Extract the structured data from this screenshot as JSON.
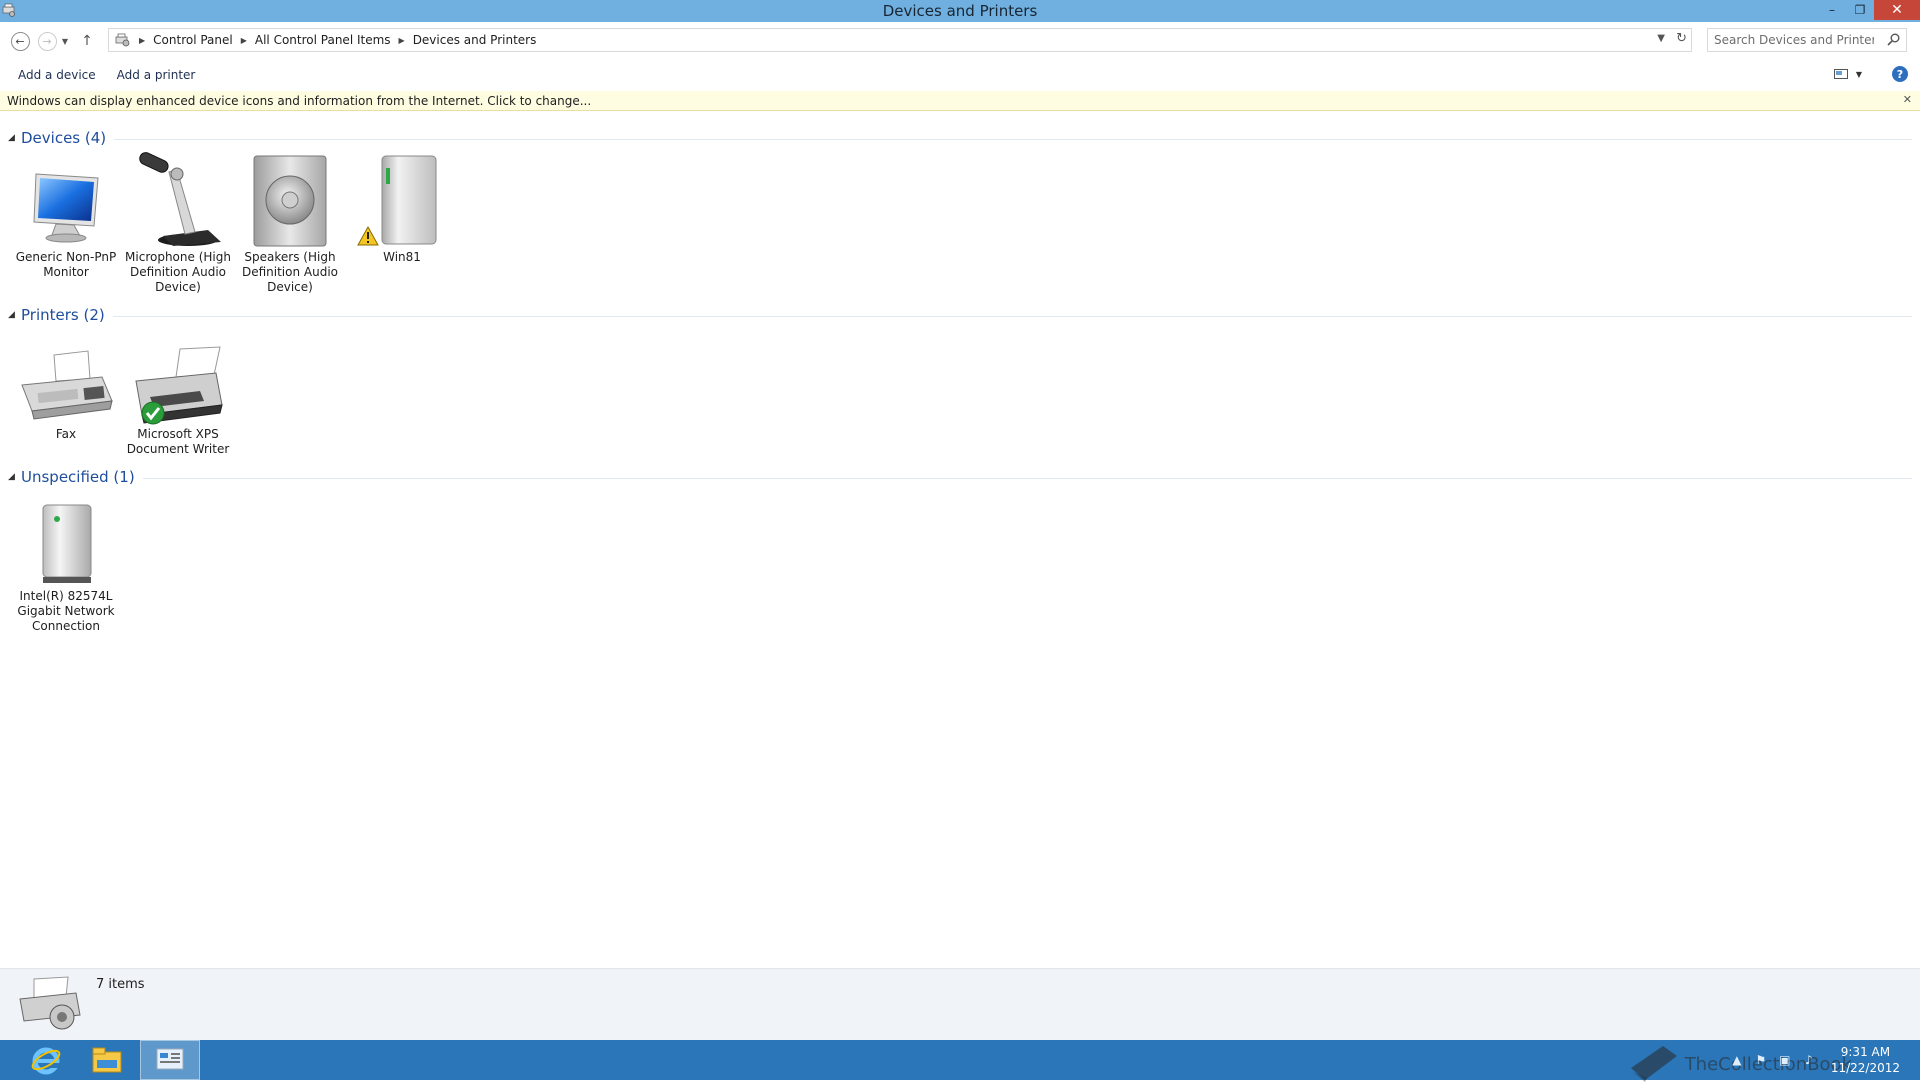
{
  "window": {
    "title": "Devices and Printers",
    "controls": {
      "minimize": "–",
      "restore": "❐",
      "close": "✕"
    }
  },
  "address": {
    "breadcrumbs": [
      "Control Panel",
      "All Control Panel Items",
      "Devices and Printers"
    ]
  },
  "search": {
    "placeholder": "Search Devices and Printers"
  },
  "commands": {
    "add_device": "Add a device",
    "add_printer": "Add a printer"
  },
  "infobar": {
    "message": "Windows can display enhanced device icons and information from the Internet. Click to change..."
  },
  "groups": {
    "devices": {
      "title": "Devices (4)",
      "items": [
        {
          "label": "Generic Non-PnP Monitor",
          "icon": "monitor-icon"
        },
        {
          "label": "Microphone (High Definition Audio Device)",
          "icon": "microphone-icon"
        },
        {
          "label": "Speakers (High Definition Audio Device)",
          "icon": "speaker-icon"
        },
        {
          "label": "Win81",
          "icon": "computer-tower-icon",
          "badge": "warning"
        }
      ]
    },
    "printers": {
      "title": "Printers (2)",
      "items": [
        {
          "label": "Fax",
          "icon": "fax-icon"
        },
        {
          "label": "Microsoft XPS Document Writer",
          "icon": "printer-icon",
          "badge": "default-check"
        }
      ]
    },
    "unspecified": {
      "title": "Unspecified (1)",
      "items": [
        {
          "label": "Intel(R) 82574L Gigabit Network Connection",
          "icon": "network-device-icon"
        }
      ]
    }
  },
  "details": {
    "count": "7 items"
  },
  "taskbar": {
    "apps": [
      "internet-explorer-icon",
      "file-explorer-icon",
      "control-panel-icon"
    ],
    "clock_time": "9:31 AM",
    "clock_date": "11/22/2012",
    "watermark": "TheCollectionBook"
  },
  "colors": {
    "titlebar": "#6fb0e0",
    "taskbar": "#2a76b8",
    "group_title": "#1e4e9c",
    "infobar": "#fffde1",
    "close_button": "#c7463a"
  }
}
